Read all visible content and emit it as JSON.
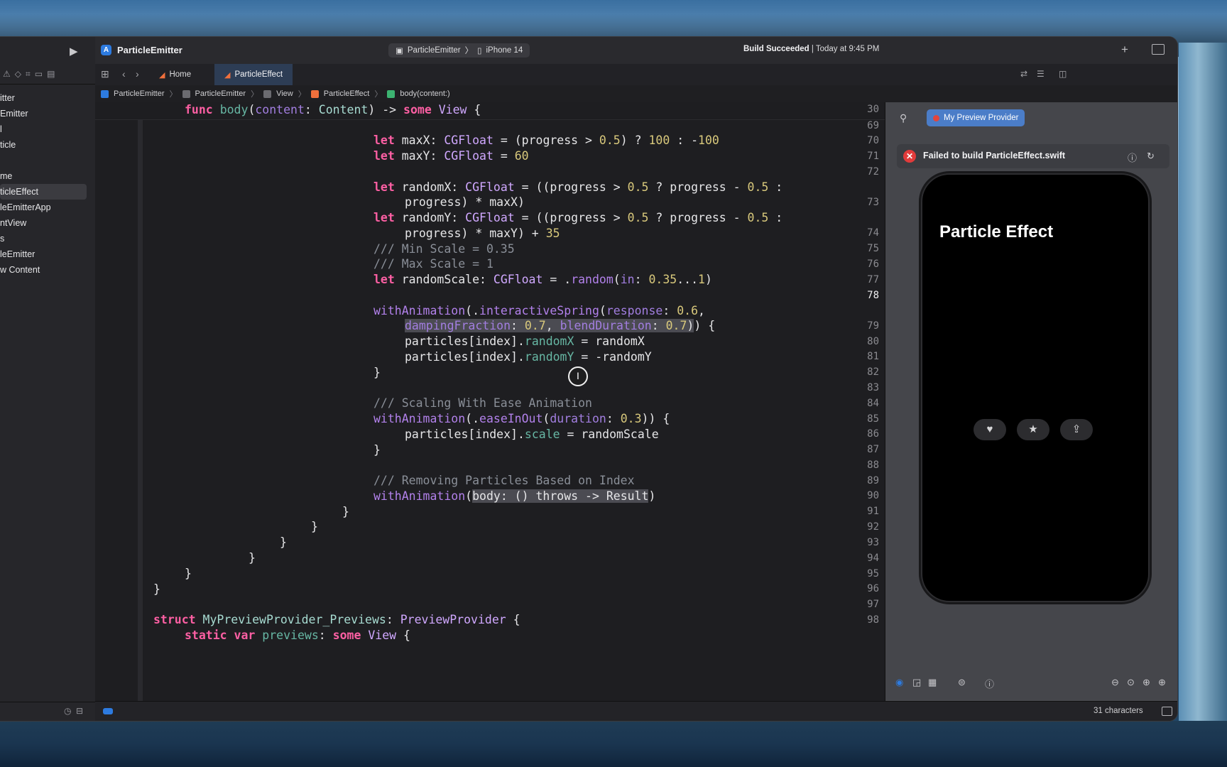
{
  "toolbar": {
    "app_title": "ParticleEmitter",
    "scheme_target": "ParticleEmitter",
    "scheme_device": "iPhone 14",
    "status_bold": "Build Succeeded",
    "status_time": "| Today at 9:45 PM"
  },
  "tabs": [
    {
      "label": "Home",
      "active": false
    },
    {
      "label": "ParticleEffect",
      "active": true
    }
  ],
  "breadcrumb": [
    "ParticleEmitter",
    "ParticleEmitter",
    "View",
    "ParticleEffect",
    "body(content:)"
  ],
  "sidebar": {
    "items": [
      "itter",
      "Emitter",
      "l",
      "ticle",
      "",
      "me",
      "ticleEffect",
      "leEmitterApp",
      "ntView",
      "s",
      "leEmitter",
      "w Content"
    ],
    "selected_index": 6
  },
  "editor": {
    "sticky_line": "30",
    "current_line": "78",
    "line_numbers": [
      "69",
      "70",
      "71",
      "72",
      "",
      "73",
      "",
      "74",
      "75",
      "76",
      "77",
      "78",
      "",
      "79",
      "80",
      "81",
      "82",
      "83",
      "84",
      "85",
      "86",
      "87",
      "88",
      "89",
      "90",
      "91",
      "92",
      "93",
      "94",
      "95",
      "96",
      "97",
      "98"
    ]
  },
  "preview": {
    "provider_label": "My Preview Provider",
    "error_message": "Failed to build ParticleEffect.swift",
    "phone_title": "Particle Effect",
    "buttons": [
      "heart-icon",
      "star-icon",
      "share-icon"
    ]
  },
  "statusbar": {
    "characters": "31 characters"
  },
  "colors": {
    "keyword": "#fc5fa3",
    "type": "#a7dbd1",
    "number": "#d9c97c",
    "comment": "#8a8f98",
    "accent": "#2d7be0",
    "error": "#e23b3b"
  }
}
